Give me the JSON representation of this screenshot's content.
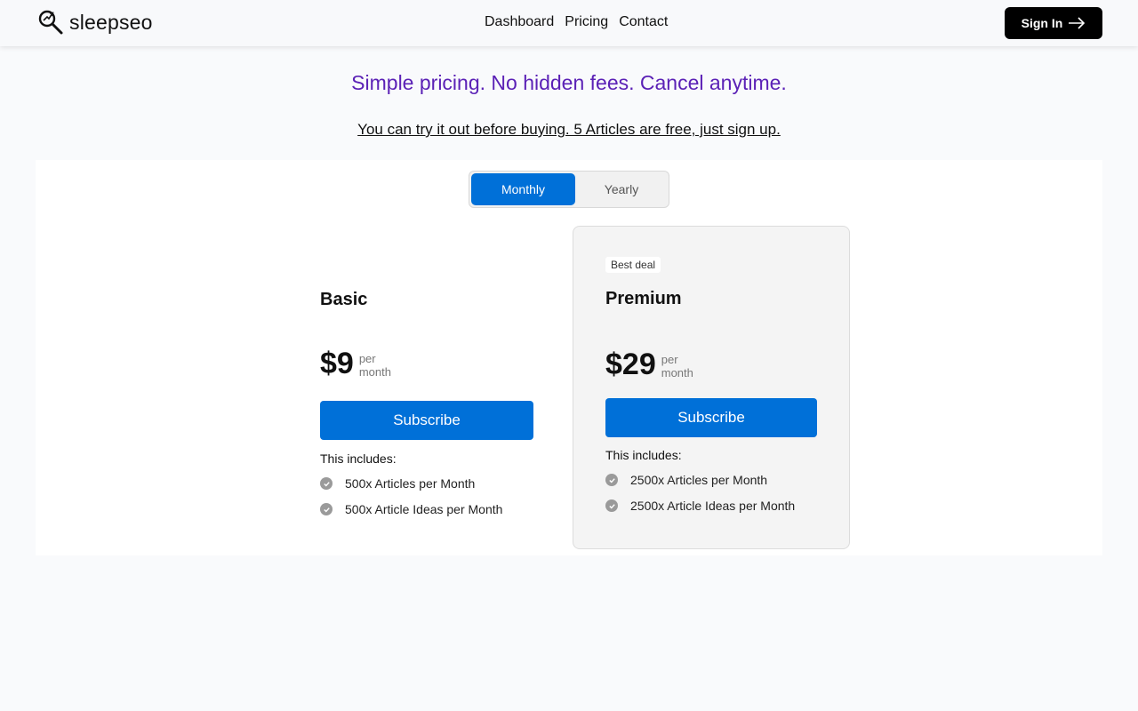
{
  "brand": {
    "name": "sleepseo"
  },
  "nav": {
    "items": [
      "Dashboard",
      "Pricing",
      "Contact"
    ]
  },
  "header": {
    "signin_label": "Sign In"
  },
  "headline": "Simple pricing. No hidden fees. Cancel anytime.",
  "subline": "You can try it out before buying. 5 Articles are free, just sign up.",
  "toggle": {
    "monthly": "Monthly",
    "yearly": "Yearly",
    "selected": "Monthly"
  },
  "plans": [
    {
      "name": "Basic",
      "price": "$9",
      "per1": "per",
      "per2": "month",
      "button": "Subscribe",
      "includes": "This includes:",
      "features": [
        "500x Articles per Month",
        "500x Article Ideas per Month"
      ]
    },
    {
      "badge": "Best deal",
      "name": "Premium",
      "price": "$29",
      "per1": "per",
      "per2": "month",
      "button": "Subscribe",
      "includes": "This includes:",
      "features": [
        "2500x Articles per Month",
        "2500x Article Ideas per Month"
      ]
    }
  ],
  "colors": {
    "accent": "#0070d8",
    "headline": "#5b21b6",
    "signin_bg": "#000000"
  }
}
